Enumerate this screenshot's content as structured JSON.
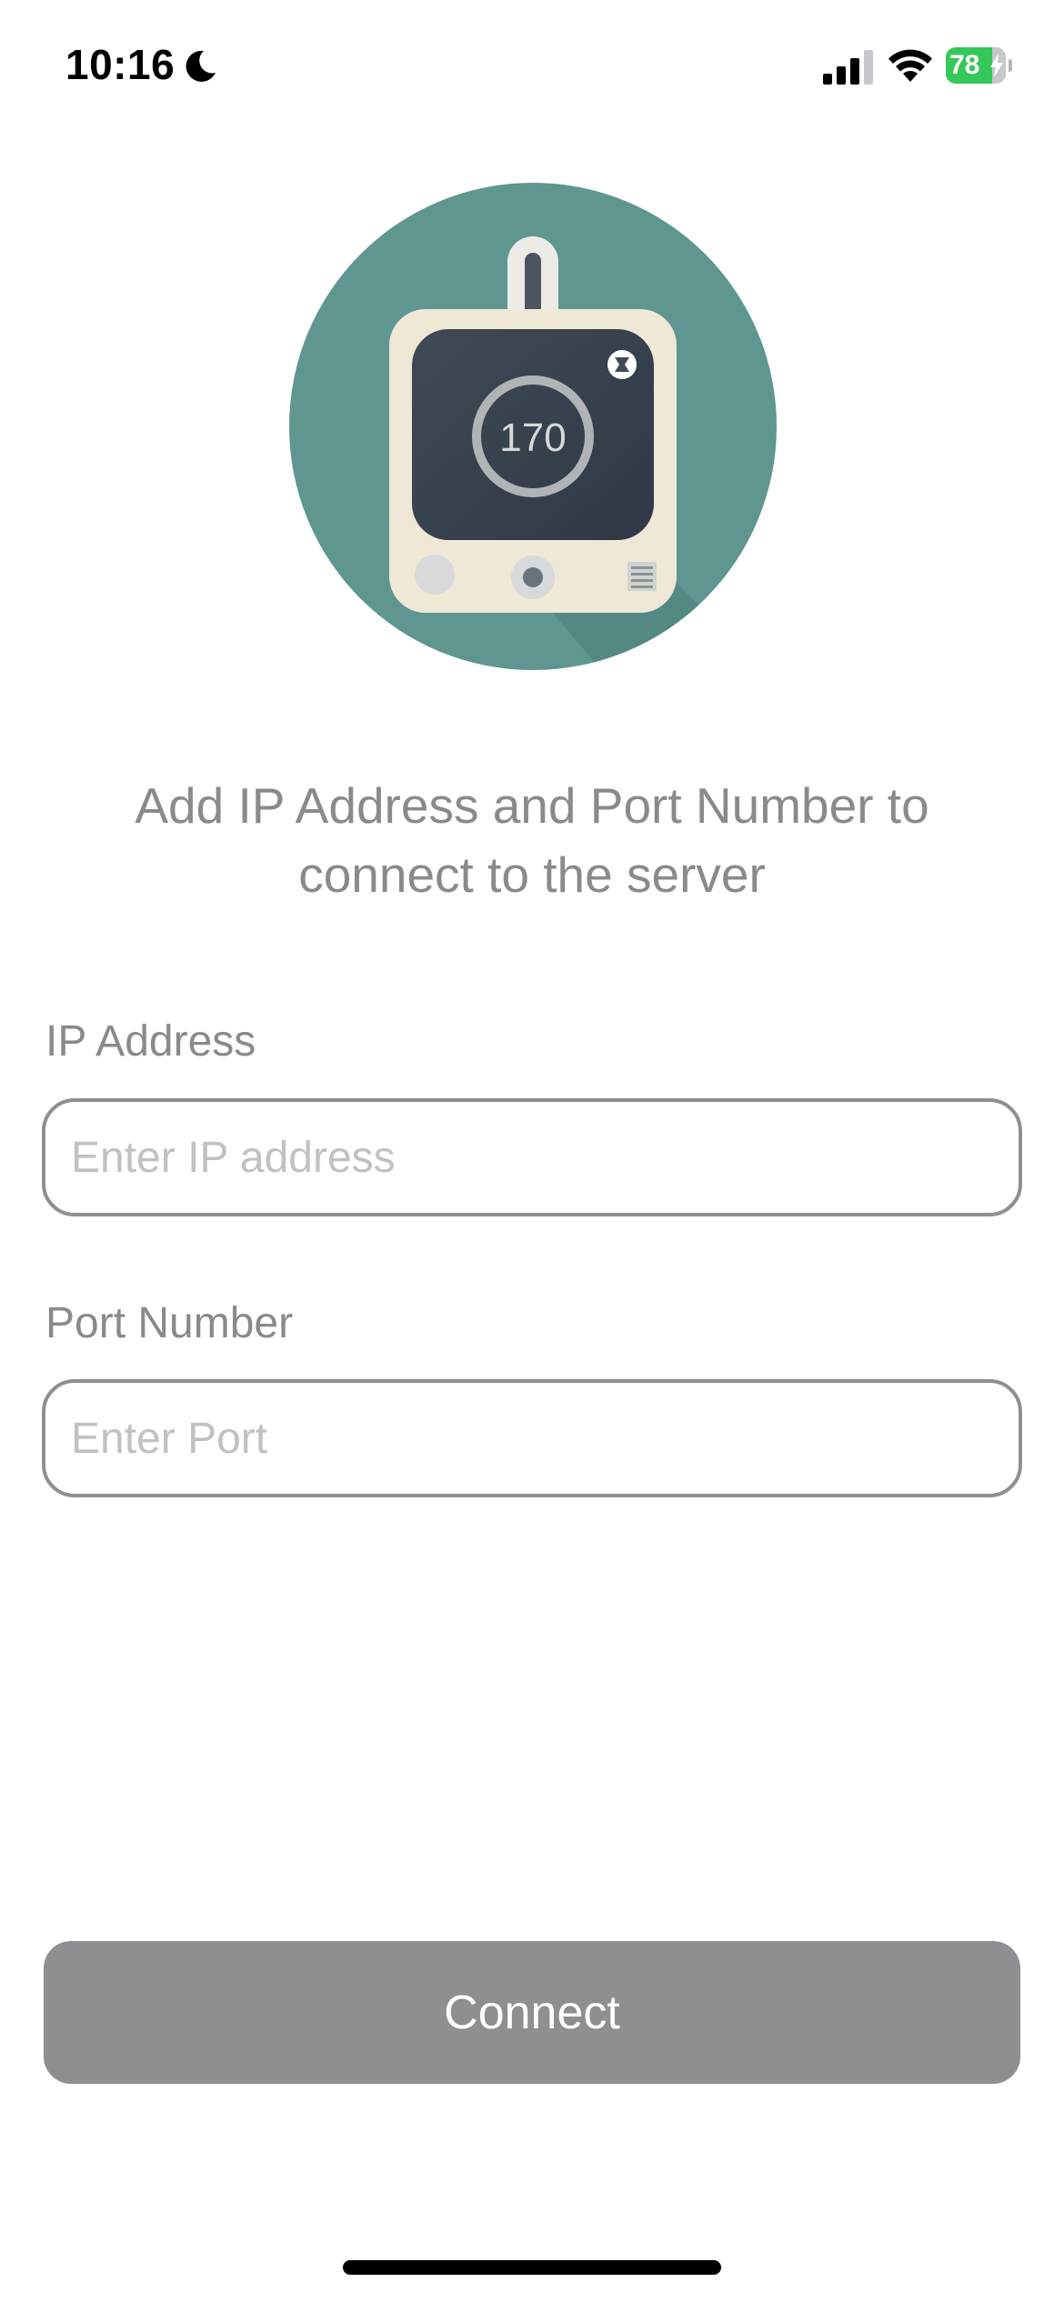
{
  "status_bar": {
    "time": "10:16",
    "battery_level": "78",
    "battery_color": "#34c759",
    "icons": [
      "moon-icon",
      "cellular-signal-icon",
      "wifi-icon",
      "battery-icon",
      "charging-bolt-icon"
    ]
  },
  "logo": {
    "display_value": "170",
    "background_color": "#5f9690"
  },
  "instruction": "Add IP Address and Port Number to connect to the server",
  "form": {
    "ip_label": "IP Address",
    "ip_value": "",
    "ip_placeholder": "Enter IP address",
    "port_label": "Port Number",
    "port_value": "",
    "port_placeholder": "Enter Port"
  },
  "connect_label": "Connect",
  "colors": {
    "button_disabled": "#8e8e93",
    "text_secondary": "#8a8a8e",
    "field_border": "#8e8e93"
  }
}
